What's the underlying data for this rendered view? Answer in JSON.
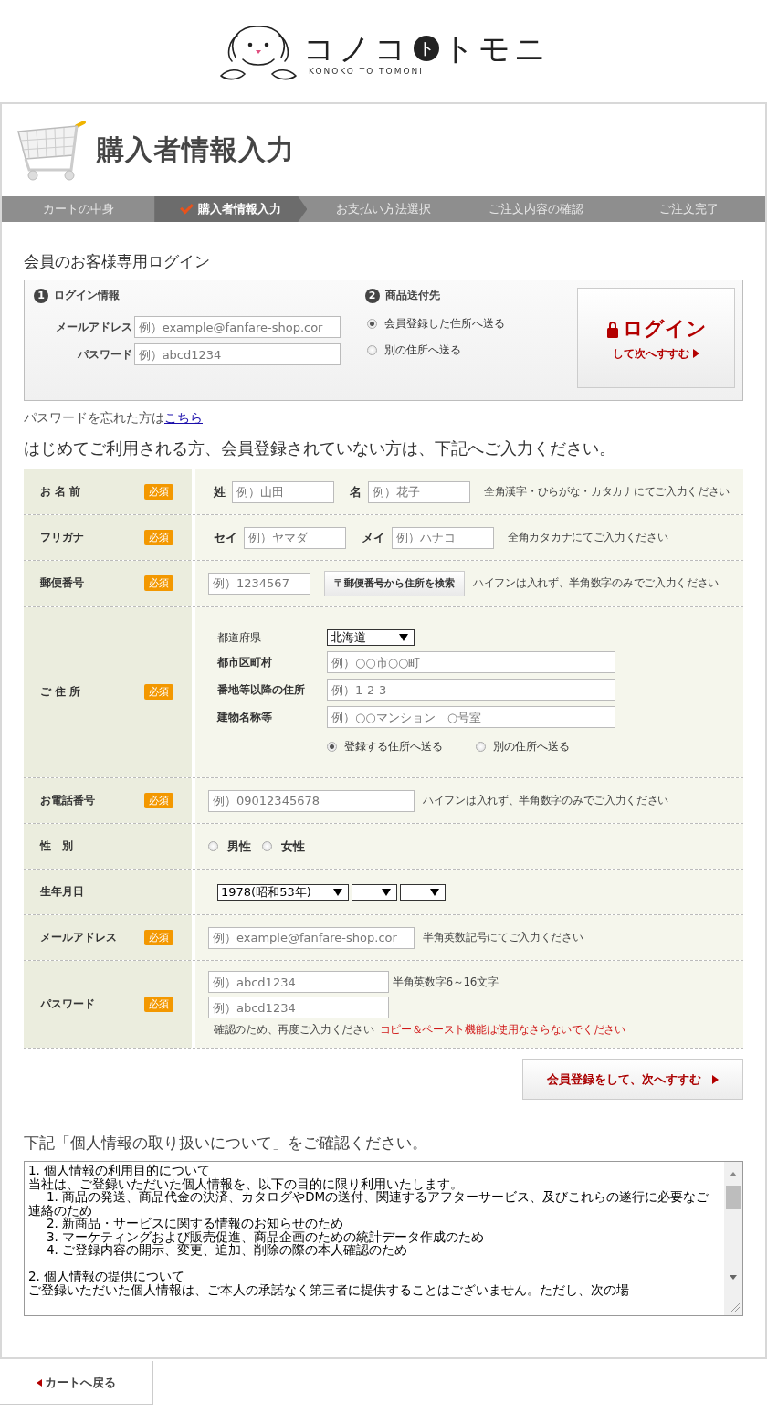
{
  "logo": {
    "wordmark": [
      "コノコ",
      "ト",
      "トモニ"
    ],
    "tagline": "KONOKO TO TOMONI"
  },
  "page_title": "購入者情報入力",
  "steps": [
    {
      "label": "カートの中身",
      "selected": false
    },
    {
      "label": "購入者情報入力",
      "selected": true
    },
    {
      "label": "お支払い方法選択",
      "selected": false
    },
    {
      "label": "ご注文内容の確認",
      "selected": false
    },
    {
      "label": "ご注文完了",
      "selected": false
    }
  ],
  "login": {
    "heading": "会員のお客様専用ログイン",
    "info": {
      "number": "1",
      "title": "ログイン情報",
      "fields": [
        {
          "label": "メールアドレス",
          "placeholder": "例）example@fanfare-shop.cor"
        },
        {
          "label": "パスワード",
          "placeholder": "例）abcd1234"
        }
      ]
    },
    "delivery": {
      "number": "2",
      "title": "商品送付先",
      "options": [
        {
          "label": "会員登録した住所へ送る",
          "selected": true
        },
        {
          "label": "別の住所へ送る",
          "selected": false
        }
      ]
    },
    "button": {
      "main": "ログイン",
      "sub": "して次へすすむ"
    },
    "forgot": {
      "text": "パスワードを忘れた方は",
      "link": "こちら"
    }
  },
  "register_heading": "はじめてご利用される方、会員登録されていない方は、下記へご入力ください。",
  "form": {
    "rows": [
      {
        "kind": "pair",
        "label": "お 名 前",
        "badge": "必須",
        "fields": [
          {
            "label": "姓",
            "placeholder": "例）山田"
          },
          {
            "label": "名",
            "placeholder": "例）花子"
          }
        ],
        "note": "全角漢字・ひらがな・カタカナにてご入力ください"
      },
      {
        "kind": "pair",
        "label": "フリガナ",
        "badge": "必須",
        "fields": [
          {
            "label": "セイ",
            "placeholder": "例）ヤマダ"
          },
          {
            "label": "メイ",
            "placeholder": "例）ハナコ"
          }
        ],
        "note": "全角カタカナにてご入力ください"
      },
      {
        "kind": "zip",
        "label": "郵便番号",
        "badge": "必須",
        "placeholder": "例）1234567",
        "button": "〒郵便番号から住所を検索",
        "note": "ハイフンは入れず、半角数字のみでご入力ください"
      },
      {
        "kind": "address",
        "label": "ご 住 所",
        "badge": "必須",
        "prefecture": {
          "label": "都道府県",
          "value": "北海道"
        },
        "fields": [
          {
            "label": "都市区町村",
            "placeholder": "例）○○市○○町"
          },
          {
            "label": "番地等以降の住所",
            "placeholder": "例）1-2-3"
          },
          {
            "label": "建物名称等",
            "placeholder": "例）○○マンション　○号室"
          }
        ],
        "options": [
          {
            "label": "登録する住所へ送る",
            "selected": true
          },
          {
            "label": "別の住所へ送る",
            "selected": false
          }
        ]
      },
      {
        "kind": "single",
        "label": "お電話番号",
        "badge": "必須",
        "placeholder": "例）09012345678",
        "note": "ハイフンは入れず、半角数字のみでご入力ください"
      },
      {
        "kind": "radio",
        "label": "性　別",
        "options": [
          {
            "label": "男性",
            "selected": false
          },
          {
            "label": "女性",
            "selected": false
          }
        ]
      },
      {
        "kind": "date",
        "label": "生年月日",
        "selects": [
          {
            "kind": "value",
            "value": "1978(昭和53年)"
          },
          {
            "kind": "empty"
          },
          {
            "kind": "empty"
          }
        ]
      },
      {
        "kind": "single",
        "label": "メールアドレス",
        "badge": "必須",
        "placeholder": "例）example@fanfare-shop.cor",
        "note": "半角英数記号にてご入力ください"
      },
      {
        "kind": "password",
        "label": "パスワード",
        "badge": "必須",
        "fields": [
          {
            "placeholder": "例）abcd1234",
            "note": "半角英数字6～16文字"
          },
          {
            "placeholder": "例）abcd1234"
          }
        ],
        "hint": "確認のため、再度ご入力ください",
        "warning": "コピー＆ペースト機能は使用なさらないでください"
      }
    ]
  },
  "submit_button": "会員登録をして、次へすすむ",
  "privacy": {
    "heading": "下記「個人情報の取り扱いについて」をご確認ください。",
    "sections": [
      {
        "title": "1.  個人情報の利用目的について",
        "body": "当社は、ご登録いただいた個人情報を、以下の目的に限り利用いたします。",
        "items": [
          "1.  商品の発送、商品代金の決済、カタログやDMの送付、関連するアフターサービス、及びこれらの遂行に必要なご連絡のため",
          "2.  新商品・サービスに関する情報のお知らせのため",
          "3.  マーケティングおよび販売促進、商品企画のための統計データ作成のため",
          "4.  ご登録内容の開示、変更、追加、削除の際の本人確認のため"
        ]
      },
      {
        "title": "2.  個人情報の提供について",
        "body": "ご登録いただいた個人情報は、ご本人の承諾なく第三者に提供することはございません。ただし、次の場"
      }
    ]
  },
  "back_button": "カートへ戻る"
}
